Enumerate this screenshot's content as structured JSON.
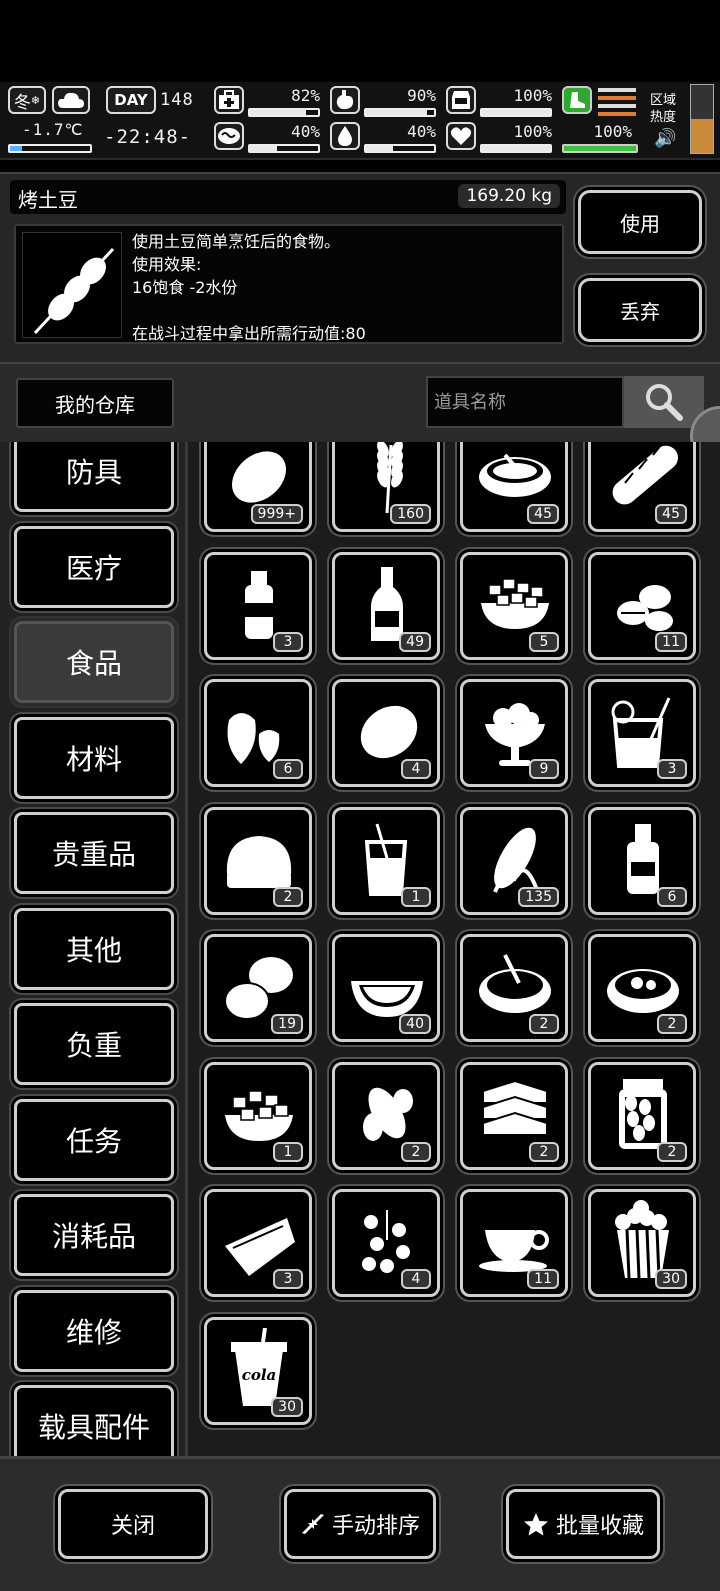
{
  "status": {
    "season": "冬",
    "season_icon": "snowflake-icon",
    "weather_icon": "cloud-icon",
    "temperature": "-1.7℃",
    "temperature_level": 0.15,
    "day_label": "DAY",
    "day": "148",
    "time": "-22:48-",
    "stats": [
      {
        "name": "health-icon",
        "value": "82%",
        "level": 0.82
      },
      {
        "name": "stomach-icon",
        "value": "90%",
        "level": 0.9
      },
      {
        "name": "armor-icon",
        "value": "100%",
        "level": 1.0
      },
      {
        "name": "mind-icon",
        "value": "40%",
        "level": 0.4
      },
      {
        "name": "water-drop-icon",
        "value": "40%",
        "level": 0.4
      },
      {
        "name": "heart-icon",
        "value": "100%",
        "level": 1.0
      }
    ],
    "stamina": {
      "value": "100%",
      "level": 1.0,
      "color": "#3fbf3f"
    },
    "zone_heat_label1": "区域",
    "zone_heat_label2": "热度"
  },
  "detail": {
    "item_name": "烤土豆",
    "weight": "169.20 kg",
    "desc_line1": "使用土豆简单烹饪后的食物。",
    "desc_line2": "使用效果:",
    "desc_line3": "16饱食 -2水份",
    "desc_line4": "在战斗过程中拿出所需行动值:80",
    "use_label": "使用",
    "discard_label": "丢弃"
  },
  "warehouse": {
    "title": "我的仓库",
    "search_placeholder": "道具名称"
  },
  "categories": [
    {
      "label": "防具",
      "active": false
    },
    {
      "label": "医疗",
      "active": false
    },
    {
      "label": "食品",
      "active": true
    },
    {
      "label": "材料",
      "active": false
    },
    {
      "label": "贵重品",
      "active": false
    },
    {
      "label": "其他",
      "active": false
    },
    {
      "label": "负重",
      "active": false
    },
    {
      "label": "任务",
      "active": false
    },
    {
      "label": "消耗品",
      "active": false
    },
    {
      "label": "维修",
      "active": false
    },
    {
      "label": "载具配件",
      "active": false
    }
  ],
  "items": [
    {
      "icon": "potato-icon",
      "count": "999+"
    },
    {
      "icon": "wheat-icon",
      "count": "160"
    },
    {
      "icon": "soup-pot-icon",
      "count": "45"
    },
    {
      "icon": "baguette-icon",
      "count": "45"
    },
    {
      "icon": "sauce-bottle-icon",
      "count": "3"
    },
    {
      "icon": "liquor-bottle-icon",
      "count": "49"
    },
    {
      "icon": "tofu-bowl-icon",
      "count": "5"
    },
    {
      "icon": "coffee-beans-icon",
      "count": "11"
    },
    {
      "icon": "strawberry-icon",
      "count": "6"
    },
    {
      "icon": "lemon-icon",
      "count": "4"
    },
    {
      "icon": "sundae-icon",
      "count": "9"
    },
    {
      "icon": "lemonade-icon",
      "count": "3"
    },
    {
      "icon": "bread-roll-icon",
      "count": "2"
    },
    {
      "icon": "juice-glass-icon",
      "count": "1"
    },
    {
      "icon": "corn-icon",
      "count": "135"
    },
    {
      "icon": "jam-bottle-icon",
      "count": "6"
    },
    {
      "icon": "potatoes-icon",
      "count": "19"
    },
    {
      "icon": "watermelon-icon",
      "count": "40"
    },
    {
      "icon": "porridge-bowl-icon",
      "count": "2"
    },
    {
      "icon": "stew-bowl-icon",
      "count": "2"
    },
    {
      "icon": "fruit-bowl-icon",
      "count": "1"
    },
    {
      "icon": "ginger-icon",
      "count": "2"
    },
    {
      "icon": "sandwich-icon",
      "count": "2"
    },
    {
      "icon": "pickle-jar-icon",
      "count": "2"
    },
    {
      "icon": "pie-slice-icon",
      "count": "3"
    },
    {
      "icon": "berries-icon",
      "count": "4"
    },
    {
      "icon": "coffee-cup-icon",
      "count": "11"
    },
    {
      "icon": "popcorn-icon",
      "count": "30"
    },
    {
      "icon": "cola-cup-icon",
      "count": "30",
      "label": "cola"
    }
  ],
  "bottom": {
    "close_label": "关闭",
    "sort_label": "手动排序",
    "favorite_label": "批量收藏"
  }
}
